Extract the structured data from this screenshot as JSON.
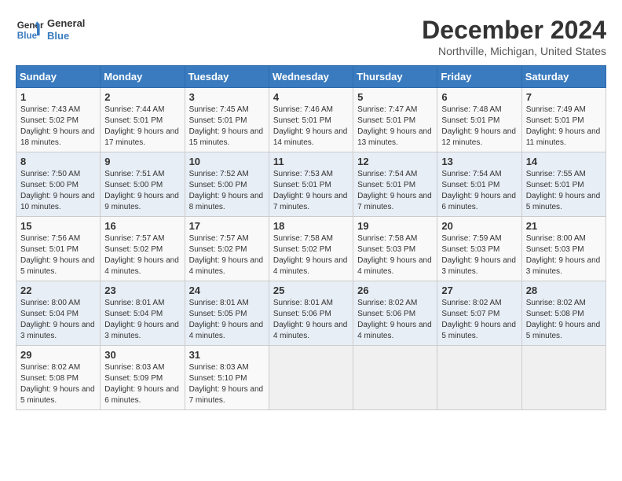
{
  "header": {
    "logo_line1": "General",
    "logo_line2": "Blue",
    "month": "December 2024",
    "location": "Northville, Michigan, United States"
  },
  "days_of_week": [
    "Sunday",
    "Monday",
    "Tuesday",
    "Wednesday",
    "Thursday",
    "Friday",
    "Saturday"
  ],
  "weeks": [
    [
      {
        "day": "1",
        "info": "Sunrise: 7:43 AM\nSunset: 5:02 PM\nDaylight: 9 hours and 18 minutes."
      },
      {
        "day": "2",
        "info": "Sunrise: 7:44 AM\nSunset: 5:01 PM\nDaylight: 9 hours and 17 minutes."
      },
      {
        "day": "3",
        "info": "Sunrise: 7:45 AM\nSunset: 5:01 PM\nDaylight: 9 hours and 15 minutes."
      },
      {
        "day": "4",
        "info": "Sunrise: 7:46 AM\nSunset: 5:01 PM\nDaylight: 9 hours and 14 minutes."
      },
      {
        "day": "5",
        "info": "Sunrise: 7:47 AM\nSunset: 5:01 PM\nDaylight: 9 hours and 13 minutes."
      },
      {
        "day": "6",
        "info": "Sunrise: 7:48 AM\nSunset: 5:01 PM\nDaylight: 9 hours and 12 minutes."
      },
      {
        "day": "7",
        "info": "Sunrise: 7:49 AM\nSunset: 5:01 PM\nDaylight: 9 hours and 11 minutes."
      }
    ],
    [
      {
        "day": "8",
        "info": "Sunrise: 7:50 AM\nSunset: 5:00 PM\nDaylight: 9 hours and 10 minutes."
      },
      {
        "day": "9",
        "info": "Sunrise: 7:51 AM\nSunset: 5:00 PM\nDaylight: 9 hours and 9 minutes."
      },
      {
        "day": "10",
        "info": "Sunrise: 7:52 AM\nSunset: 5:00 PM\nDaylight: 9 hours and 8 minutes."
      },
      {
        "day": "11",
        "info": "Sunrise: 7:53 AM\nSunset: 5:01 PM\nDaylight: 9 hours and 7 minutes."
      },
      {
        "day": "12",
        "info": "Sunrise: 7:54 AM\nSunset: 5:01 PM\nDaylight: 9 hours and 7 minutes."
      },
      {
        "day": "13",
        "info": "Sunrise: 7:54 AM\nSunset: 5:01 PM\nDaylight: 9 hours and 6 minutes."
      },
      {
        "day": "14",
        "info": "Sunrise: 7:55 AM\nSunset: 5:01 PM\nDaylight: 9 hours and 5 minutes."
      }
    ],
    [
      {
        "day": "15",
        "info": "Sunrise: 7:56 AM\nSunset: 5:01 PM\nDaylight: 9 hours and 5 minutes."
      },
      {
        "day": "16",
        "info": "Sunrise: 7:57 AM\nSunset: 5:02 PM\nDaylight: 9 hours and 4 minutes."
      },
      {
        "day": "17",
        "info": "Sunrise: 7:57 AM\nSunset: 5:02 PM\nDaylight: 9 hours and 4 minutes."
      },
      {
        "day": "18",
        "info": "Sunrise: 7:58 AM\nSunset: 5:02 PM\nDaylight: 9 hours and 4 minutes."
      },
      {
        "day": "19",
        "info": "Sunrise: 7:58 AM\nSunset: 5:03 PM\nDaylight: 9 hours and 4 minutes."
      },
      {
        "day": "20",
        "info": "Sunrise: 7:59 AM\nSunset: 5:03 PM\nDaylight: 9 hours and 3 minutes."
      },
      {
        "day": "21",
        "info": "Sunrise: 8:00 AM\nSunset: 5:03 PM\nDaylight: 9 hours and 3 minutes."
      }
    ],
    [
      {
        "day": "22",
        "info": "Sunrise: 8:00 AM\nSunset: 5:04 PM\nDaylight: 9 hours and 3 minutes."
      },
      {
        "day": "23",
        "info": "Sunrise: 8:01 AM\nSunset: 5:04 PM\nDaylight: 9 hours and 3 minutes."
      },
      {
        "day": "24",
        "info": "Sunrise: 8:01 AM\nSunset: 5:05 PM\nDaylight: 9 hours and 4 minutes."
      },
      {
        "day": "25",
        "info": "Sunrise: 8:01 AM\nSunset: 5:06 PM\nDaylight: 9 hours and 4 minutes."
      },
      {
        "day": "26",
        "info": "Sunrise: 8:02 AM\nSunset: 5:06 PM\nDaylight: 9 hours and 4 minutes."
      },
      {
        "day": "27",
        "info": "Sunrise: 8:02 AM\nSunset: 5:07 PM\nDaylight: 9 hours and 5 minutes."
      },
      {
        "day": "28",
        "info": "Sunrise: 8:02 AM\nSunset: 5:08 PM\nDaylight: 9 hours and 5 minutes."
      }
    ],
    [
      {
        "day": "29",
        "info": "Sunrise: 8:02 AM\nSunset: 5:08 PM\nDaylight: 9 hours and 5 minutes."
      },
      {
        "day": "30",
        "info": "Sunrise: 8:03 AM\nSunset: 5:09 PM\nDaylight: 9 hours and 6 minutes."
      },
      {
        "day": "31",
        "info": "Sunrise: 8:03 AM\nSunset: 5:10 PM\nDaylight: 9 hours and 7 minutes."
      },
      {
        "day": "",
        "info": ""
      },
      {
        "day": "",
        "info": ""
      },
      {
        "day": "",
        "info": ""
      },
      {
        "day": "",
        "info": ""
      }
    ]
  ]
}
